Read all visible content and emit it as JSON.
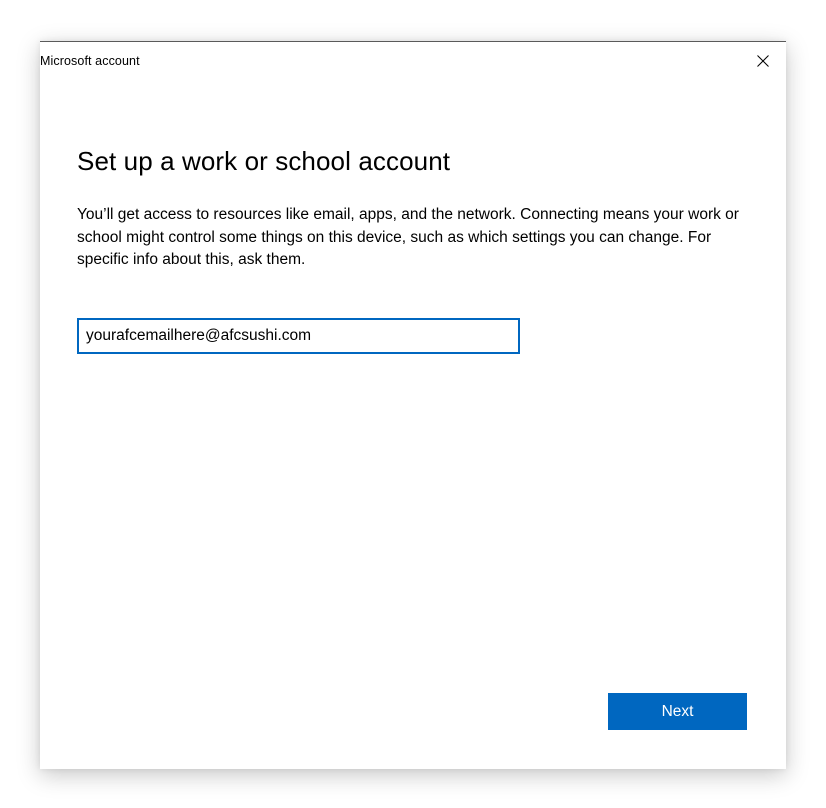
{
  "window": {
    "title": "Microsoft account",
    "close_icon": "close-icon"
  },
  "main": {
    "heading": "Set up a work or school account",
    "description": "You’ll get access to resources like email, apps, and the network. Connecting means your work or school might control some things on this device, such as which settings you can change. For specific info about this, ask them.",
    "email_value": "yourafcemailhere@afcsushi.com",
    "next_label": "Next"
  },
  "colors": {
    "accent": "#0067c0",
    "text": "#000000",
    "background": "#ffffff"
  }
}
